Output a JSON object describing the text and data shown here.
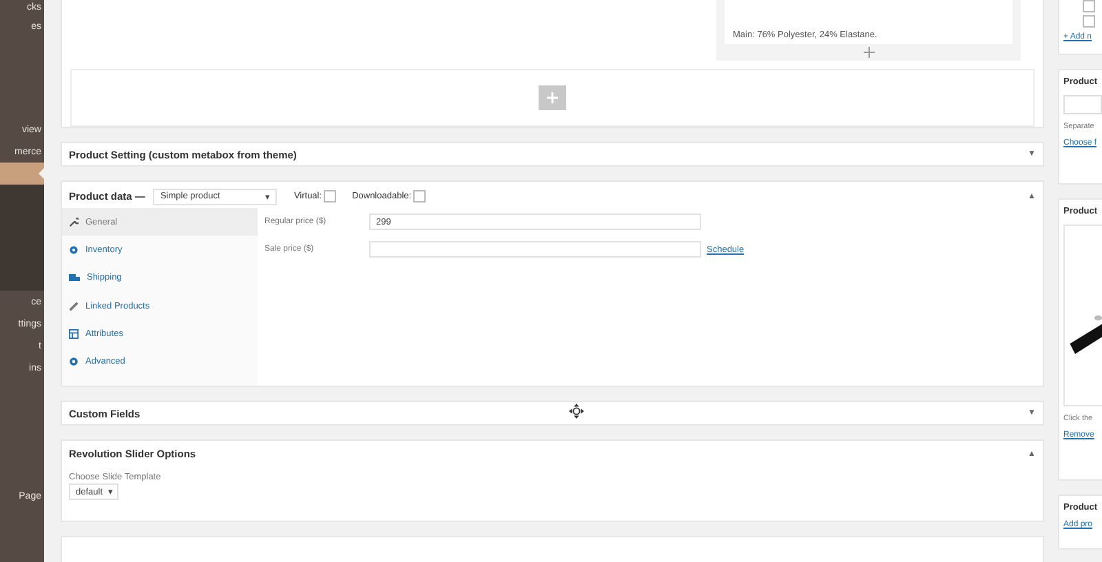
{
  "sidebar": {
    "items": [
      {
        "label": "cks",
        "selected": false
      },
      {
        "label": "es",
        "selected": false
      },
      {
        "label": "view",
        "selected": false
      },
      {
        "label": "merce",
        "selected": false
      },
      {
        "selected": true
      },
      {
        "label": "ce",
        "selected": false
      },
      {
        "label": "ttings",
        "selected": false
      },
      {
        "label": "t",
        "selected": false
      },
      {
        "label": "ins",
        "selected": false
      },
      {
        "label": "Page",
        "selected": false
      }
    ]
  },
  "builder": {
    "module_text": "Main: 76% Polyester, 24% Elastane."
  },
  "product_setting": {
    "title": "Product Setting (custom metabox from theme)",
    "toggle": "▼"
  },
  "product_data": {
    "title": "Product data —",
    "type_select": "Simple product",
    "type_caret": "▾",
    "virtual": {
      "label": "Virtual:",
      "checked": false
    },
    "downloadable": {
      "label": "Downloadable:",
      "checked": false
    },
    "toggle": "▲",
    "tabs": [
      {
        "label": "General",
        "selected": true
      },
      {
        "label": "Inventory",
        "selected": false
      },
      {
        "label": "Shipping",
        "selected": false
      },
      {
        "label": "Linked Products",
        "selected": false
      },
      {
        "label": "Attributes",
        "selected": false
      },
      {
        "label": "Advanced",
        "selected": false
      }
    ],
    "fields": [
      {
        "label": "Regular price ($)",
        "value": "299"
      },
      {
        "label": "Sale price ($)",
        "link": "Schedule"
      }
    ]
  },
  "custom_fields": {
    "title": "Custom Fields",
    "toggle": "▼"
  },
  "revolution_slider": {
    "title": "Revolution Slider Options",
    "toggle": "▲",
    "field_label": "Choose Slide Template",
    "select": "default",
    "select_caret": "▾"
  },
  "right_column": {
    "checkboxes": [
      {
        "checked": false
      },
      {
        "checked": false
      }
    ],
    "add_link": "+ Add n",
    "tags_title": "Product",
    "tags_hint": "Separate",
    "tags_link": "Choose f",
    "image_title": "Product",
    "image_hint": "Click the",
    "image_link": "Remove",
    "gallery_title": "Product",
    "gallery_link": "Add pro"
  }
}
